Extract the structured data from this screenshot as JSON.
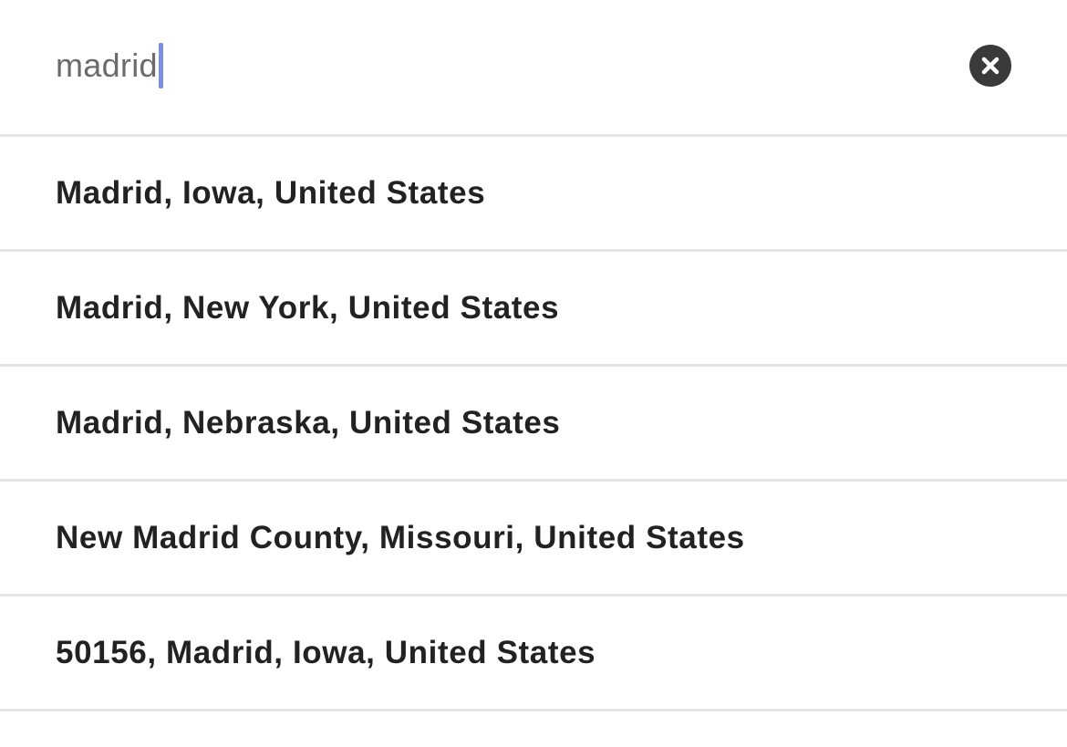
{
  "search": {
    "value": "madrid",
    "clear_icon": "close-circle-icon"
  },
  "results": [
    {
      "label": "Madrid, Iowa, United States"
    },
    {
      "label": "Madrid, New York, United States"
    },
    {
      "label": "Madrid, Nebraska, United States"
    },
    {
      "label": "New Madrid County, Missouri, United States"
    },
    {
      "label": "50156, Madrid, Iowa, United States"
    }
  ],
  "colors": {
    "caret": "#7b8fe0",
    "clear_button": "#3a3a3a",
    "divider": "#e4e4e4",
    "result_text": "#222222",
    "search_text": "#6b6b6b"
  }
}
